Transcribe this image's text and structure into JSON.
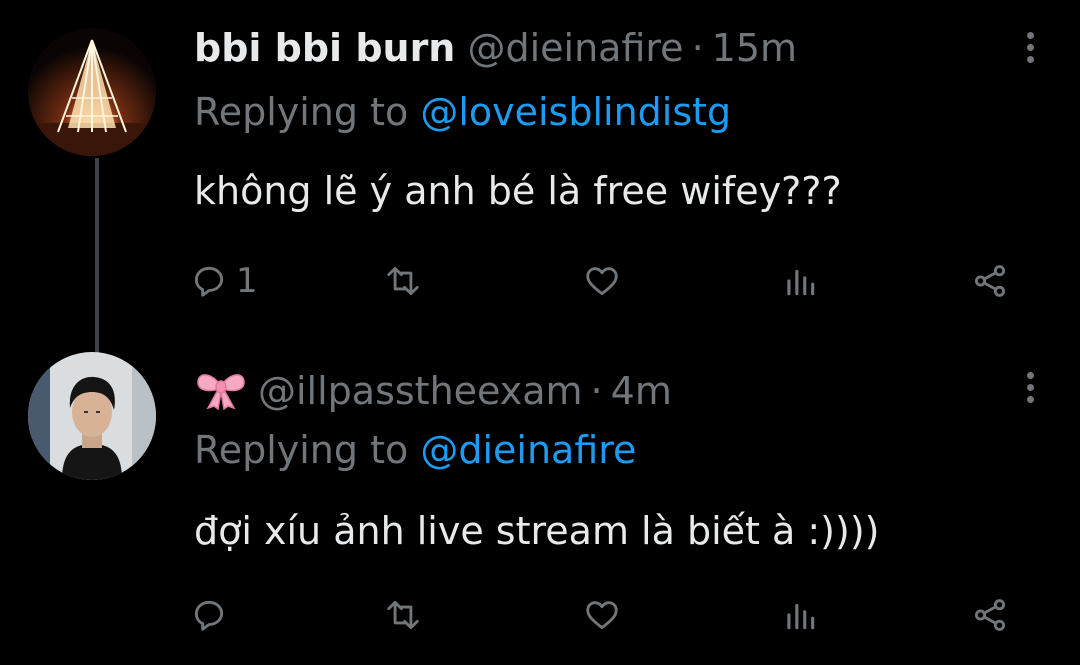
{
  "colors": {
    "background": "#000000",
    "text": "#e7e9ea",
    "muted": "#71767b",
    "link": "#1d9bf0",
    "thread_line": "#3d4247"
  },
  "tweets": [
    {
      "display_name": "bbi bbi burn",
      "handle": "@dieinafire",
      "separator": "·",
      "time": "15m",
      "replying_prefix": "Replying to",
      "replying_to": "@loveisblindistg",
      "text": "không lẽ ý anh bé là free wifey???",
      "reply_count": "1",
      "avatar": "bonfire-photo"
    },
    {
      "display_name_icon": "ribbon-bow-emoji",
      "handle": "@illpasstheexam",
      "separator": "·",
      "time": "4m",
      "replying_prefix": "Replying to",
      "replying_to": "@dieinafire",
      "text": "đợi xíu ảnh live stream là biết à :))))",
      "reply_count": "",
      "avatar": "man-portrait-photo"
    }
  ],
  "action_icons": [
    "reply-icon",
    "retweet-icon",
    "like-icon",
    "stats-icon",
    "share-icon"
  ]
}
